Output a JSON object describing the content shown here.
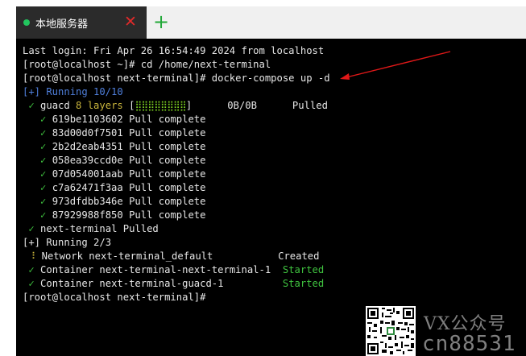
{
  "tab": {
    "title": "本地服务器",
    "status_color": "#22c55e",
    "close_icon": "close-icon",
    "add_icon": "plus-icon",
    "close_glyph": "✕",
    "add_glyph": "+"
  },
  "terminal": {
    "lines": [
      {
        "segments": [
          {
            "text": "Last login: Fri Apr 26 16:54:49 2024 from localhost",
            "color": "white"
          }
        ]
      },
      {
        "segments": [
          {
            "text": "[root@localhost ~]# cd /home/next-terminal",
            "color": "white"
          }
        ]
      },
      {
        "segments": [
          {
            "text": "[root@localhost next-terminal]# docker-compose up -d",
            "color": "white"
          }
        ]
      },
      {
        "segments": [
          {
            "text": "[+] Running 10/10",
            "color": "blue"
          }
        ]
      },
      {
        "segments": [
          {
            "text": " ✓ ",
            "color": "green"
          },
          {
            "text": "guacd ",
            "color": "white"
          },
          {
            "text": "8 layers ",
            "color": "yellow"
          },
          {
            "text": "[",
            "color": "white"
          },
          {
            "text": "⣿⣿⣿⣿⣿⣿⣿⣿",
            "color": "bar"
          },
          {
            "text": "]      0B/0B      Pulled",
            "color": "white"
          }
        ]
      },
      {
        "segments": [
          {
            "text": "   ✓ ",
            "color": "green"
          },
          {
            "text": "619be1103602 Pull complete",
            "color": "white"
          }
        ]
      },
      {
        "segments": [
          {
            "text": "   ✓ ",
            "color": "green"
          },
          {
            "text": "83d00d0f7501 Pull complete",
            "color": "white"
          }
        ]
      },
      {
        "segments": [
          {
            "text": "   ✓ ",
            "color": "green"
          },
          {
            "text": "2b2d2eab4351 Pull complete",
            "color": "white"
          }
        ]
      },
      {
        "segments": [
          {
            "text": "   ✓ ",
            "color": "green"
          },
          {
            "text": "058ea39ccd0e Pull complete",
            "color": "white"
          }
        ]
      },
      {
        "segments": [
          {
            "text": "   ✓ ",
            "color": "green"
          },
          {
            "text": "07d054001aab Pull complete",
            "color": "white"
          }
        ]
      },
      {
        "segments": [
          {
            "text": "   ✓ ",
            "color": "green"
          },
          {
            "text": "c7a62471f3aa Pull complete",
            "color": "white"
          }
        ]
      },
      {
        "segments": [
          {
            "text": "   ✓ ",
            "color": "green"
          },
          {
            "text": "973dfdbb346e Pull complete",
            "color": "white"
          }
        ]
      },
      {
        "segments": [
          {
            "text": "   ✓ ",
            "color": "green"
          },
          {
            "text": "87929988f850 Pull complete",
            "color": "white"
          }
        ]
      },
      {
        "segments": [
          {
            "text": " ✓ ",
            "color": "green"
          },
          {
            "text": "next-terminal Pulled",
            "color": "white"
          }
        ]
      },
      {
        "segments": [
          {
            "text": "[+] Running 2/3",
            "color": "white"
          }
        ]
      },
      {
        "segments": [
          {
            "text": " ⠸ ",
            "color": "yellow"
          },
          {
            "text": "Network next-terminal_default           Created",
            "color": "white"
          }
        ]
      },
      {
        "segments": [
          {
            "text": " ✓ ",
            "color": "green"
          },
          {
            "text": "Container next-terminal-next-terminal-1  ",
            "color": "white"
          },
          {
            "text": "Started",
            "color": "green"
          }
        ]
      },
      {
        "segments": [
          {
            "text": " ✓ ",
            "color": "green"
          },
          {
            "text": "Container next-terminal-guacd-1          ",
            "color": "white"
          },
          {
            "text": "Started",
            "color": "green"
          }
        ]
      },
      {
        "segments": [
          {
            "text": "[root@localhost next-terminal]# ",
            "color": "white"
          }
        ]
      }
    ]
  },
  "watermark": {
    "line1": "VX公众号",
    "line2": "cn88531"
  },
  "colors": {
    "terminal_bg": "#000000",
    "tab_bg": "#2b2b2b",
    "close_red": "#e02a2a",
    "add_green": "#22a838",
    "arrow_red": "#e01818",
    "running_blue": "#4f7fdc",
    "ok_green": "#3fc23f",
    "layers_yellow": "#c8b43c"
  }
}
